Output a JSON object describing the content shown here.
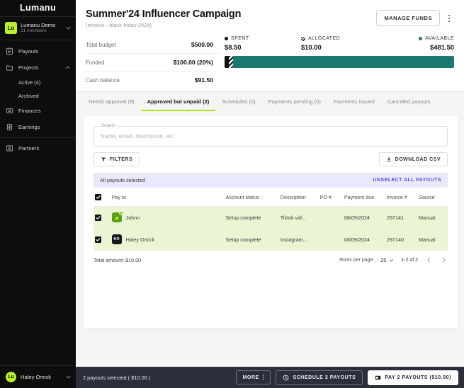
{
  "sidebar": {
    "brand": "Lumanu",
    "org": {
      "avatar_initials": "Lu",
      "name": "Lumanu Demo",
      "members": "21 members"
    },
    "nav": [
      {
        "label": "Payouts",
        "icon": "receipt-icon"
      },
      {
        "label": "Projects",
        "icon": "folder-icon"
      },
      {
        "label": "Active (4)",
        "icon": ""
      },
      {
        "label": "Archived",
        "icon": ""
      },
      {
        "label": "Finances",
        "icon": "money-bill-icon"
      },
      {
        "label": "Earnings",
        "icon": "dollar-document-icon"
      },
      {
        "label": "Partners",
        "icon": "id-card-icon"
      }
    ],
    "user": {
      "avatar_initials": "Lu",
      "name": "Haley Omick"
    }
  },
  "header": {
    "title": "Summer'24 Influencer Campaign",
    "subtitle": "(revolve---black-friday-2024)",
    "manage_funds_label": "MANAGE FUNDS"
  },
  "budget": {
    "rows": [
      {
        "label": "Total budget",
        "value": "$500.00"
      },
      {
        "label": "Funded",
        "value": "$100.00 (20%)"
      },
      {
        "label": "Cash balance",
        "value": "$91.50"
      }
    ]
  },
  "chart_data": {
    "type": "bar",
    "title": "Campaign funds breakdown",
    "categories": [
      "SPENT",
      "ALLOCATED",
      "AVAILABLE"
    ],
    "values": [
      8.5,
      10.0,
      481.5
    ],
    "value_labels": [
      "$8.50",
      "$10.00",
      "$481.50"
    ],
    "colors": [
      "#111111",
      "#111111",
      "#1b7a70"
    ],
    "legend_position": "top",
    "total": 500.0,
    "ylabel": "",
    "xlabel": ""
  },
  "tabs": [
    {
      "label": "Needs approval (8)",
      "active": false
    },
    {
      "label": "Approved but unpaid (2)",
      "active": true
    },
    {
      "label": "Scheduled (0)",
      "active": false
    },
    {
      "label": "Payments pending (0)",
      "active": false
    },
    {
      "label": "Payments issued",
      "active": false
    },
    {
      "label": "Canceled payouts",
      "active": false
    }
  ],
  "search": {
    "label": "Search",
    "value": "",
    "placeholder": "Name, email, description, etc"
  },
  "toolbar": {
    "filters_label": "FILTERS",
    "download_label": "DOWNLOAD CSV"
  },
  "selection_banner": {
    "text": "All payouts selected",
    "action": "UNSELECT ALL PAYOUTS"
  },
  "table": {
    "columns": [
      "Pay to",
      "Account status",
      "Description",
      "PO #",
      "Payment due",
      "Invoice #",
      "Source"
    ],
    "rows": [
      {
        "checked": true,
        "avatar_type": "image",
        "avatar_initials": "",
        "verified": true,
        "pay_to": "Johnn",
        "account_status": "Setup complete",
        "description": "Tiktok vid...",
        "po": "",
        "payment_due": "08/09/2024",
        "invoice": "297141",
        "source": "Manual"
      },
      {
        "checked": true,
        "avatar_type": "initials",
        "avatar_initials": "HO",
        "verified": false,
        "pay_to": "Haley Omick",
        "account_status": "Setup complete",
        "description": "Instagram...",
        "po": "",
        "payment_due": "08/09/2024",
        "invoice": "297140",
        "source": "Manual"
      }
    ],
    "total_amount": "Total amount: $10.00",
    "rows_per_page_label": "Rows per page:",
    "rows_per_page_value": "25",
    "range": "1-2 of 2"
  },
  "bottom_bar": {
    "status": "2 payouts selected ( $10.00 )",
    "more_label": "MORE",
    "schedule_label": "SCHEDULE 2 PAYOUTS",
    "pay_label": "PAY 2 PAYOUTS ($10.00)"
  },
  "colors": {
    "accent_lime": "#a8e612",
    "teal": "#1b7a70",
    "purple": "#5b4ce0",
    "row_selected": "#eaf5d4"
  }
}
